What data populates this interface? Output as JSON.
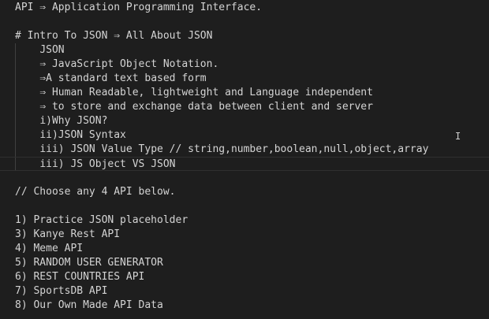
{
  "editor": {
    "lines": [
      {
        "text": "API ⇒ Application Programming Interface.",
        "indent": "",
        "active": false
      },
      {
        "text": "",
        "indent": "",
        "active": false
      },
      {
        "text": "# Intro To JSON ⇒ All About JSON",
        "indent": "",
        "active": false
      },
      {
        "text": "JSON",
        "indent": "    ",
        "active": false
      },
      {
        "text": "⇒ JavaScript Object Notation.",
        "indent": "    ",
        "active": false
      },
      {
        "text": "⇒A standard text based form",
        "indent": "    ",
        "active": false
      },
      {
        "text": "⇒ Human Readable, lightweight and Language independent",
        "indent": "    ",
        "active": false
      },
      {
        "text": "⇒ to store and exchange data between client and server",
        "indent": "    ",
        "active": false
      },
      {
        "text": "i)Why JSON?",
        "indent": "    ",
        "active": false
      },
      {
        "text": "ii)JSON Syntax",
        "indent": "    ",
        "active": false
      },
      {
        "text": "iii) JSON Value Type // string,number,boolean,null,object,array",
        "indent": "    ",
        "active": false
      },
      {
        "text": "iii) JS Object VS JSON",
        "indent": "    ",
        "active": true
      },
      {
        "text": "",
        "indent": "",
        "active": false
      },
      {
        "text": "// Choose any 4 API below.",
        "indent": "",
        "active": false
      },
      {
        "text": "",
        "indent": "",
        "active": false
      },
      {
        "text": "1) Practice JSON placeholder",
        "indent": "",
        "active": false
      },
      {
        "text": "3) Kanye Rest API",
        "indent": "",
        "active": false
      },
      {
        "text": "4) Meme API",
        "indent": "",
        "active": false
      },
      {
        "text": "5) RANDOM USER GENERATOR",
        "indent": "",
        "active": false
      },
      {
        "text": "6) REST COUNTRIES API",
        "indent": "",
        "active": false
      },
      {
        "text": "7) SportsDB API",
        "indent": "",
        "active": false
      },
      {
        "text": "8) Our Own Made API Data",
        "indent": "",
        "active": false
      }
    ]
  }
}
